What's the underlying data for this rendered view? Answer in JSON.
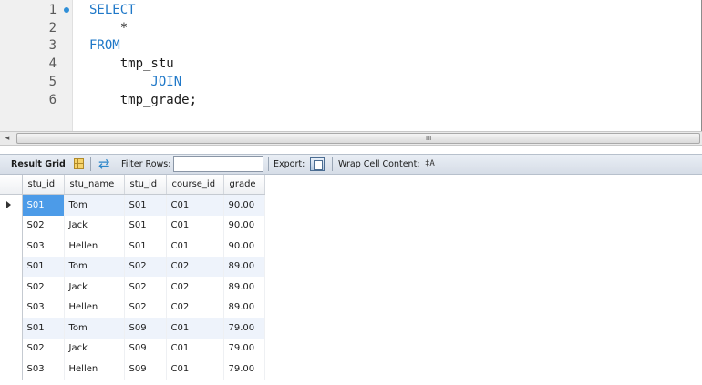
{
  "editor": {
    "lines": [
      {
        "num": "1",
        "text": "SELECT",
        "keyword": true,
        "marker": true
      },
      {
        "num": "2",
        "text": "    *",
        "keyword": false,
        "marker": false
      },
      {
        "num": "3",
        "text": "FROM",
        "keyword": true,
        "marker": false
      },
      {
        "num": "4",
        "text": "    tmp_stu",
        "keyword": false,
        "marker": false
      },
      {
        "num": "5",
        "text": "        JOIN",
        "keyword": true,
        "marker": false
      },
      {
        "num": "6",
        "text": "    tmp_grade;",
        "keyword": false,
        "marker": false
      }
    ]
  },
  "scrollbar": {
    "left_arrow": "◂",
    "grip": "III"
  },
  "toolbar": {
    "result_grid_label": "Result Grid",
    "filter_rows_label": "Filter Rows:",
    "filter_rows_value": "",
    "export_label": "Export:",
    "wrap_cell_label": "Wrap Cell Content:",
    "wrap_icon_glyph": "‡A"
  },
  "results": {
    "columns": [
      "stu_id",
      "stu_name",
      "stu_id",
      "course_id",
      "grade"
    ],
    "rows": [
      [
        "S01",
        "Tom",
        "S01",
        "C01",
        "90.00"
      ],
      [
        "S02",
        "Jack",
        "S01",
        "C01",
        "90.00"
      ],
      [
        "S03",
        "Hellen",
        "S01",
        "C01",
        "90.00"
      ],
      [
        "S01",
        "Tom",
        "S02",
        "C02",
        "89.00"
      ],
      [
        "S02",
        "Jack",
        "S02",
        "C02",
        "89.00"
      ],
      [
        "S03",
        "Hellen",
        "S02",
        "C02",
        "89.00"
      ],
      [
        "S01",
        "Tom",
        "S09",
        "C01",
        "79.00"
      ],
      [
        "S02",
        "Jack",
        "S09",
        "C01",
        "79.00"
      ],
      [
        "S03",
        "Hellen",
        "S09",
        "C01",
        "79.00"
      ]
    ],
    "selected_row": 0,
    "selected_col": 0
  },
  "colors": {
    "keyword": "#1f78c8",
    "selection": "#4c9be8",
    "alt_row": "#eef3fb"
  }
}
